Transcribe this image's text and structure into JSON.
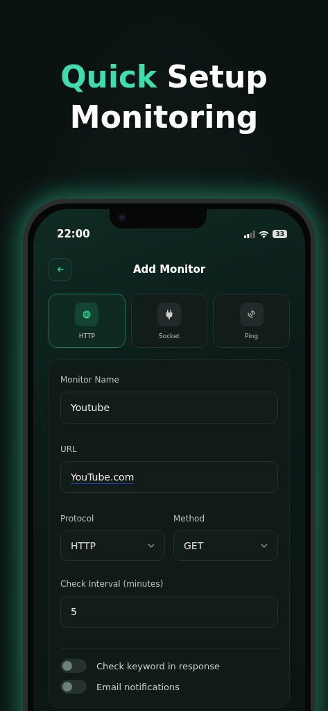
{
  "headline": [
    [
      {
        "text": "Quick",
        "accent": true
      },
      {
        "text": "Setup",
        "accent": false
      }
    ],
    [
      {
        "text": "Monitoring",
        "accent": false
      }
    ]
  ],
  "status_bar": {
    "time": "22:00",
    "battery": "33"
  },
  "screen_title": "Add Monitor",
  "types": [
    {
      "label": "HTTP",
      "selected": true
    },
    {
      "label": "Socket",
      "selected": false
    },
    {
      "label": "Ping",
      "selected": false
    }
  ],
  "form": {
    "name_label": "Monitor Name",
    "name_value": "Youtube",
    "url_label": "URL",
    "url_value": "YouTube.com",
    "protocol_label": "Protocol",
    "protocol_value": "HTTP",
    "method_label": "Method",
    "method_value": "GET",
    "interval_label": "Check Interval (minutes)",
    "interval_value": "5"
  },
  "toggles": [
    {
      "label": "Check keyword in response",
      "on": false
    },
    {
      "label": "Email notifications",
      "on": false
    }
  ]
}
